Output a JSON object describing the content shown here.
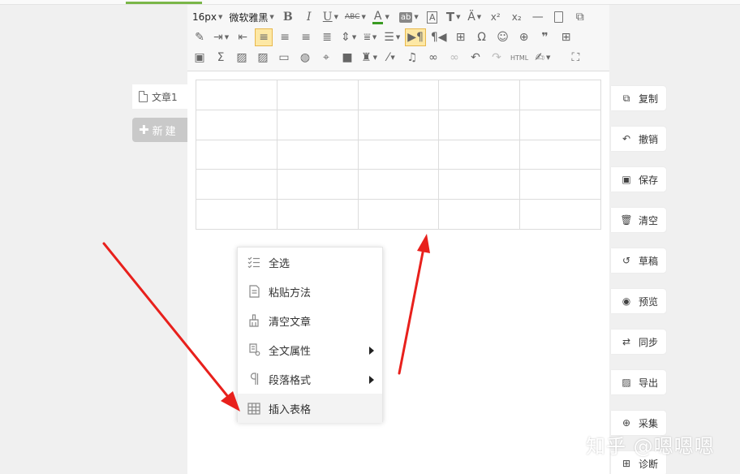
{
  "doc_list": {
    "doc_title": "文章1",
    "new_label": "新建"
  },
  "toolbar": {
    "font_size": "16px",
    "font_family": "微软雅黑",
    "html_label": "HTML",
    "bold": "B",
    "italic": "I",
    "underline": "U",
    "strike": "ABC",
    "font_color": "A",
    "text_box": "A",
    "superscript": "x²",
    "subscript": "x₂",
    "omega": "Ω",
    "sigma": "Σ",
    "quote": "❞"
  },
  "context_menu": {
    "items": [
      {
        "label": "全选",
        "icon": "select-all-icon",
        "submenu": false
      },
      {
        "label": "粘贴方法",
        "icon": "paste-icon",
        "submenu": false
      },
      {
        "label": "清空文章",
        "icon": "broom-icon",
        "submenu": false
      },
      {
        "label": "全文属性",
        "icon": "doc-properties-icon",
        "submenu": true
      },
      {
        "label": "段落格式",
        "icon": "paragraph-icon",
        "submenu": true
      },
      {
        "label": "插入表格",
        "icon": "table-icon",
        "submenu": false,
        "highlighted": true
      }
    ]
  },
  "actions": {
    "items": [
      {
        "label": "复制",
        "icon": "copy-icon"
      },
      {
        "label": "撤销",
        "icon": "undo-icon"
      },
      {
        "label": "保存",
        "icon": "save-icon"
      },
      {
        "label": "清空",
        "icon": "trash-icon"
      },
      {
        "label": "草稿",
        "icon": "history-icon"
      },
      {
        "label": "预览",
        "icon": "eye-icon"
      },
      {
        "label": "同步",
        "icon": "sync-icon"
      },
      {
        "label": "导出",
        "icon": "export-icon"
      },
      {
        "label": "采集",
        "icon": "zoom-icon"
      },
      {
        "label": "诊断",
        "icon": "plus-box-icon"
      }
    ]
  },
  "watermark": "知乎 @嗯嗯嗯",
  "colors": {
    "accent_green": "#7ab648",
    "active_tool": "#fde8a5",
    "arrow_red": "#e8201c",
    "font_color_bar": "#3a9b22"
  }
}
